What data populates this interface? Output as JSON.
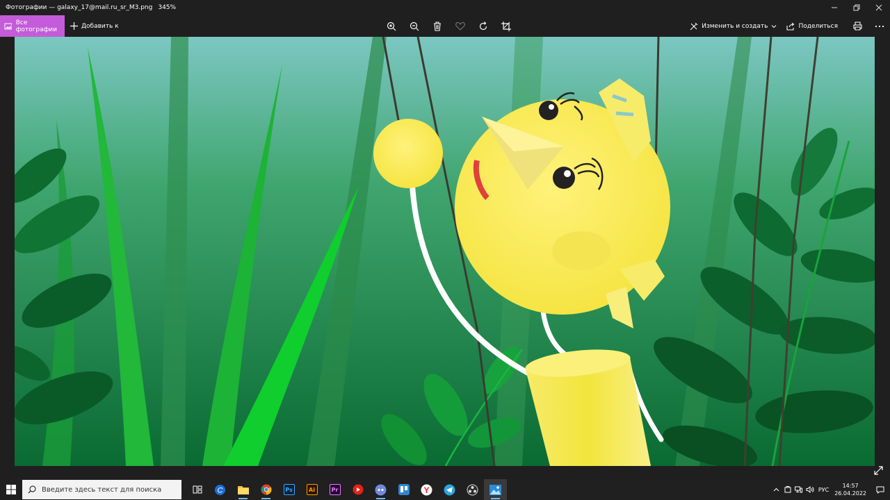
{
  "window": {
    "title": "Фотографии — galaxy_17@mail.ru_sr_M3.png",
    "zoom": "345%"
  },
  "toolbar": {
    "all_photos_label": "Все фотографии",
    "add_to_label": "Добавить к",
    "edit_create_label": "Изменить и создать",
    "share_label": "Поделиться"
  },
  "search": {
    "placeholder": "Введите здесь текст для поиска"
  },
  "tray": {
    "language": "РУС",
    "time": "14:57",
    "date": "26.04.2022"
  },
  "taskbar_apps": [
    "task-view",
    "cortana-c",
    "file-explorer",
    "chrome",
    "photoshop",
    "illustrator",
    "premiere",
    "youtube",
    "discord",
    "trello",
    "yandex",
    "telegram",
    "obs",
    "photos"
  ],
  "colors": {
    "accent": "#c45bd9",
    "background": "#1f1f1f"
  }
}
